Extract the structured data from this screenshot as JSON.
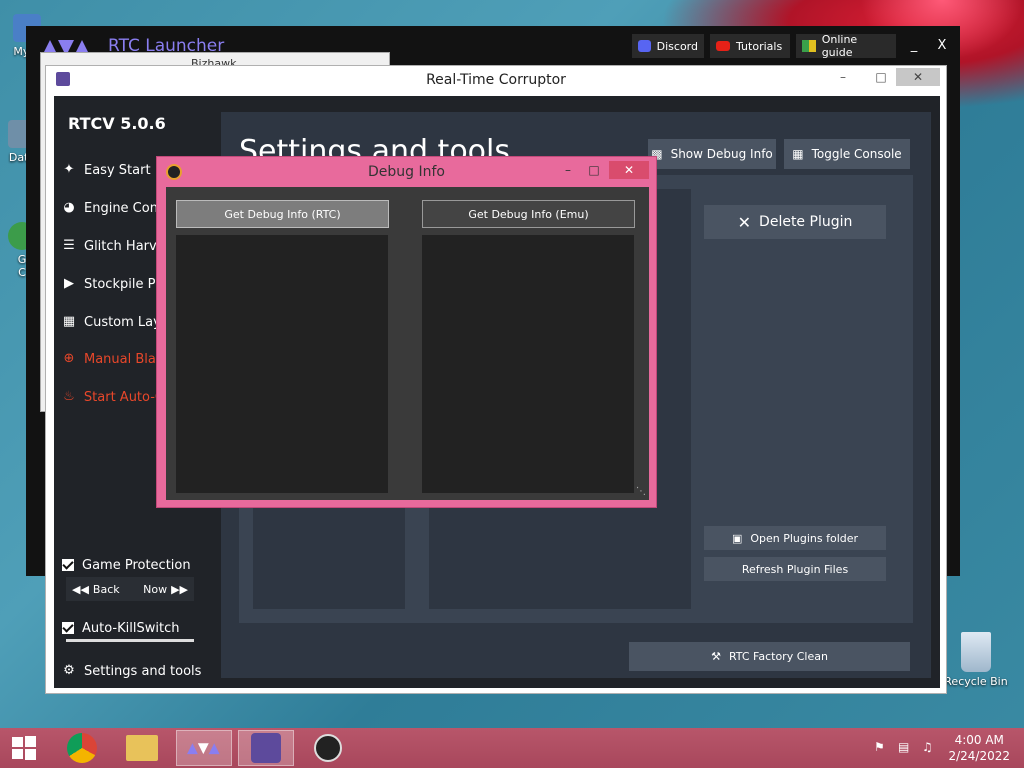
{
  "desktop": {
    "icons": [
      {
        "label": "My C"
      },
      {
        "label": "Data"
      },
      {
        "label": "G"
      },
      {
        "label": "C"
      },
      {
        "label": "Recycle Bin"
      }
    ]
  },
  "launcher": {
    "title": "RTC Launcher",
    "buttons": {
      "discord": "Discord",
      "tutorials": "Tutorials",
      "online_guide": "Online guide"
    },
    "minimize": "_",
    "close": "X"
  },
  "behind_window": {
    "title": "Bizhawk"
  },
  "rtc": {
    "title": "Real-Time Corruptor",
    "version": "RTCV 5.0.6",
    "nav": [
      {
        "label": "Easy Start",
        "icon": "wand-icon"
      },
      {
        "label": "Engine Config",
        "icon": "gauge-icon"
      },
      {
        "label": "Glitch Harvester",
        "icon": "layers-icon"
      },
      {
        "label": "Stockpile Player",
        "icon": "play-icon"
      },
      {
        "label": "Custom Layout",
        "icon": "grid-icon"
      },
      {
        "label": "Manual Blast",
        "icon": "crosshair-icon"
      },
      {
        "label": "Start Auto-Corrupt",
        "icon": "flame-icon"
      }
    ],
    "game_protection": "Game Protection",
    "back": "Back",
    "now": "Now",
    "auto_killswitch": "Auto-KillSwitch",
    "settings_nav": "Settings and tools",
    "page_title": "Settings and tools",
    "show_debug": "Show Debug Info",
    "toggle_console": "Toggle Console",
    "delete_plugin": "Delete Plugin",
    "open_plugins": "Open Plugins folder",
    "refresh_plugins": "Refresh Plugin Files",
    "factory_clean": "RTC Factory Clean"
  },
  "debug": {
    "title": "Debug Info",
    "btn_rtc": "Get Debug Info (RTC)",
    "btn_emu": "Get Debug Info (Emu)"
  },
  "taskbar": {
    "time": "4:00 AM",
    "date": "2/24/2022"
  },
  "colors": {
    "accent_red": "#e8472a",
    "debug_border": "#e86a9c",
    "launcher_title": "#8a7ef0"
  }
}
